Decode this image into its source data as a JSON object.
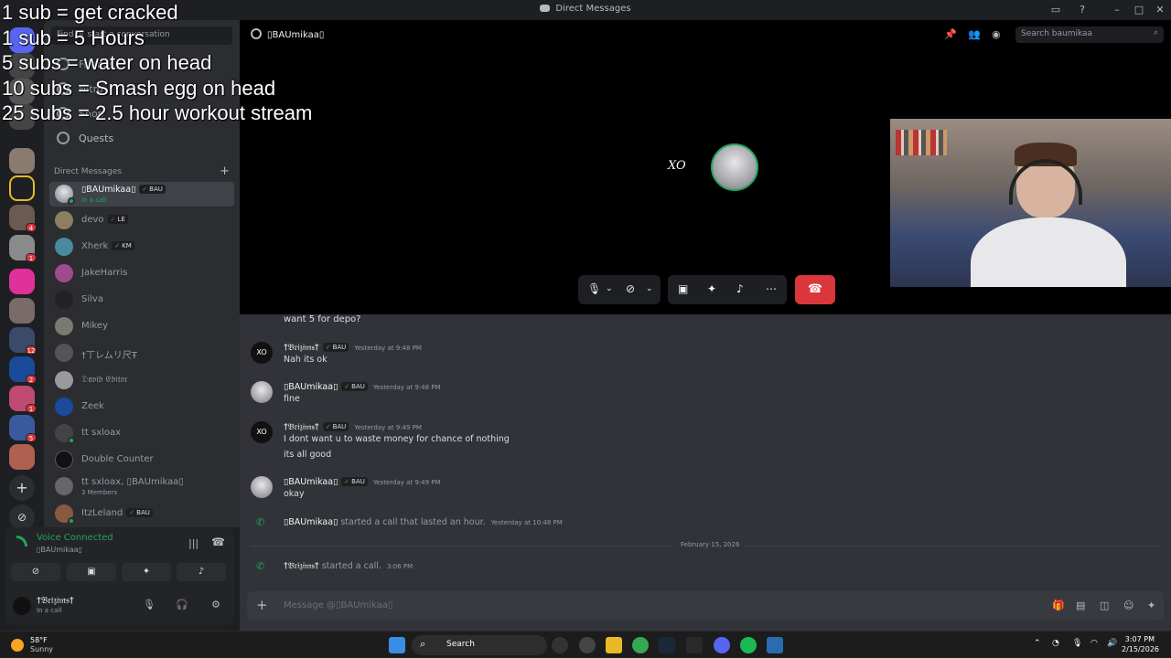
{
  "window": {
    "title": "Direct Messages"
  },
  "overlay": {
    "lines": [
      "1 sub = get cracked",
      "1 sub = 5 Hours",
      "5 subs = water on head",
      "10 subs = Smash egg on head",
      "25 subs = 2.5 hour workout stream"
    ]
  },
  "rail": {
    "badges": [
      "4",
      "1",
      "12",
      "2",
      "1",
      "5"
    ]
  },
  "sidebar": {
    "find_placeholder": "Find or start a conversation",
    "nav": [
      "Friends",
      "Nitro",
      "Shop",
      "Quests"
    ],
    "dm_header": "Direct Messages",
    "dms": [
      {
        "name": "▯BAUmikaa▯",
        "tag": "BAU",
        "sub": "In a call",
        "active": true
      },
      {
        "name": "devo",
        "tag": "LE"
      },
      {
        "name": "Xherk",
        "tag": "KM"
      },
      {
        "name": "JakeHarris"
      },
      {
        "name": "Silva"
      },
      {
        "name": "Mikey"
      },
      {
        "name": "†丅レムリ尺Ŧ"
      },
      {
        "name": "𝔇𝔞𝔳𝔦𝔡 𝔈𝔡𝔦𝔱𝔬𝔯"
      },
      {
        "name": "Zeek"
      },
      {
        "name": "tt sxloax"
      },
      {
        "name": "Double Counter"
      },
      {
        "name": "tt sxloax, ▯BAUmikaa▯",
        "sub": "3 Members"
      },
      {
        "name": "ItzLeland",
        "tag": "BAU"
      }
    ]
  },
  "voice": {
    "status": "Voice Connected",
    "channel": "▯BAUmikaa▯"
  },
  "user": {
    "name": "†𝔅𝔯𝔦𝔷𝔦𝔪𝔰†",
    "status": "In a call"
  },
  "call": {
    "recipient": "▯BAUmikaa▯",
    "search_placeholder": "Search baumikaa",
    "avatar_text": "XO"
  },
  "messages": {
    "fragment": "want 5 for depo?",
    "items": [
      {
        "author": "†𝔅𝔯𝔦𝔷𝔦𝔪𝔰†",
        "tag": "BAU",
        "time": "Yesterday at 9:48 PM",
        "lines": [
          "Nah its ok"
        ],
        "avatar": "dark"
      },
      {
        "author": "▯BAUmikaa▯",
        "tag": "BAU",
        "time": "Yesterday at 9:48 PM",
        "lines": [
          "fine"
        ],
        "avatar": "light"
      },
      {
        "author": "†𝔅𝔯𝔦𝔷𝔦𝔪𝔰†",
        "tag": "BAU",
        "time": "Yesterday at 9:49 PM",
        "lines": [
          "I dont want u to waste money for chance of nothing",
          "its all good"
        ],
        "avatar": "dark"
      },
      {
        "author": "▯BAUmikaa▯",
        "tag": "BAU",
        "time": "Yesterday at 9:49 PM",
        "lines": [
          "okay"
        ],
        "avatar": "light"
      }
    ],
    "system": [
      {
        "actor": "▯BAUmikaa▯",
        "text": "started a call that lasted an hour.",
        "time": "Yesterday at 10:48 PM"
      },
      {
        "actor": "†𝔅𝔯𝔦𝔷𝔦𝔪𝔰†",
        "text": "started a call.",
        "time": "3:06 PM"
      }
    ],
    "divider": "February 15, 2026",
    "composer_placeholder": "Message @▯BAUmikaa▯"
  },
  "taskbar": {
    "weather_temp": "58°F",
    "weather_desc": "Sunny",
    "search": "Search",
    "time": "3:07 PM",
    "date": "2/15/2026"
  },
  "colors": {
    "accent_green": "#23a55a",
    "end_call_red": "#da373c",
    "background": "#313338",
    "sidebar": "#2b2d31"
  }
}
